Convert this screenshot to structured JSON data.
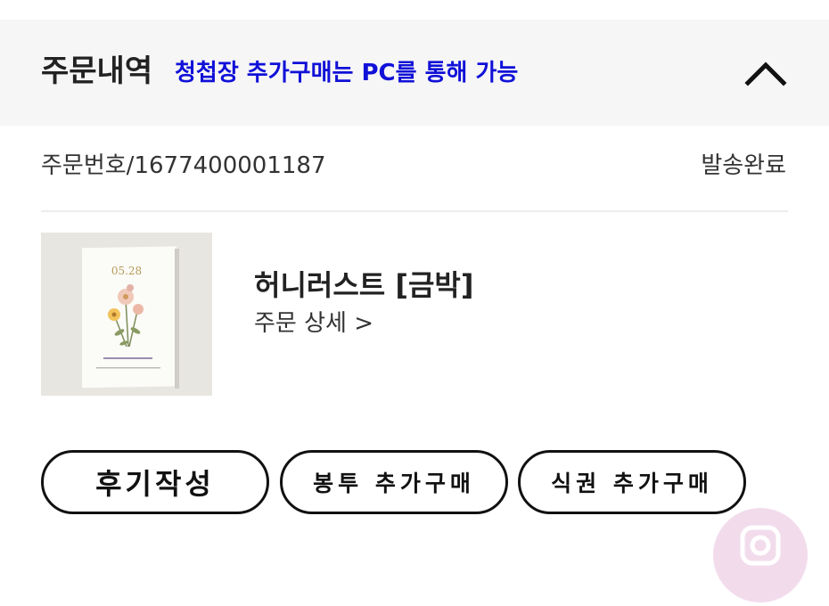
{
  "header": {
    "title": "주문내역",
    "notice": "청첩장 추가구매는 PC를 통해 가능"
  },
  "order": {
    "number_label": "주문번호/1677400001187",
    "status": "발송완료"
  },
  "product": {
    "name": "허니러스트 [금박]",
    "detail_link": "주문 상세 >",
    "card_date": "05.28"
  },
  "actions": {
    "review": "후기작성",
    "envelope": "봉투 추가구매",
    "ticket": "식권 추가구매"
  },
  "colors": {
    "notice": "#1010d8",
    "header_bg": "#f6f6f6",
    "fab_bg": "#f2dcec"
  }
}
